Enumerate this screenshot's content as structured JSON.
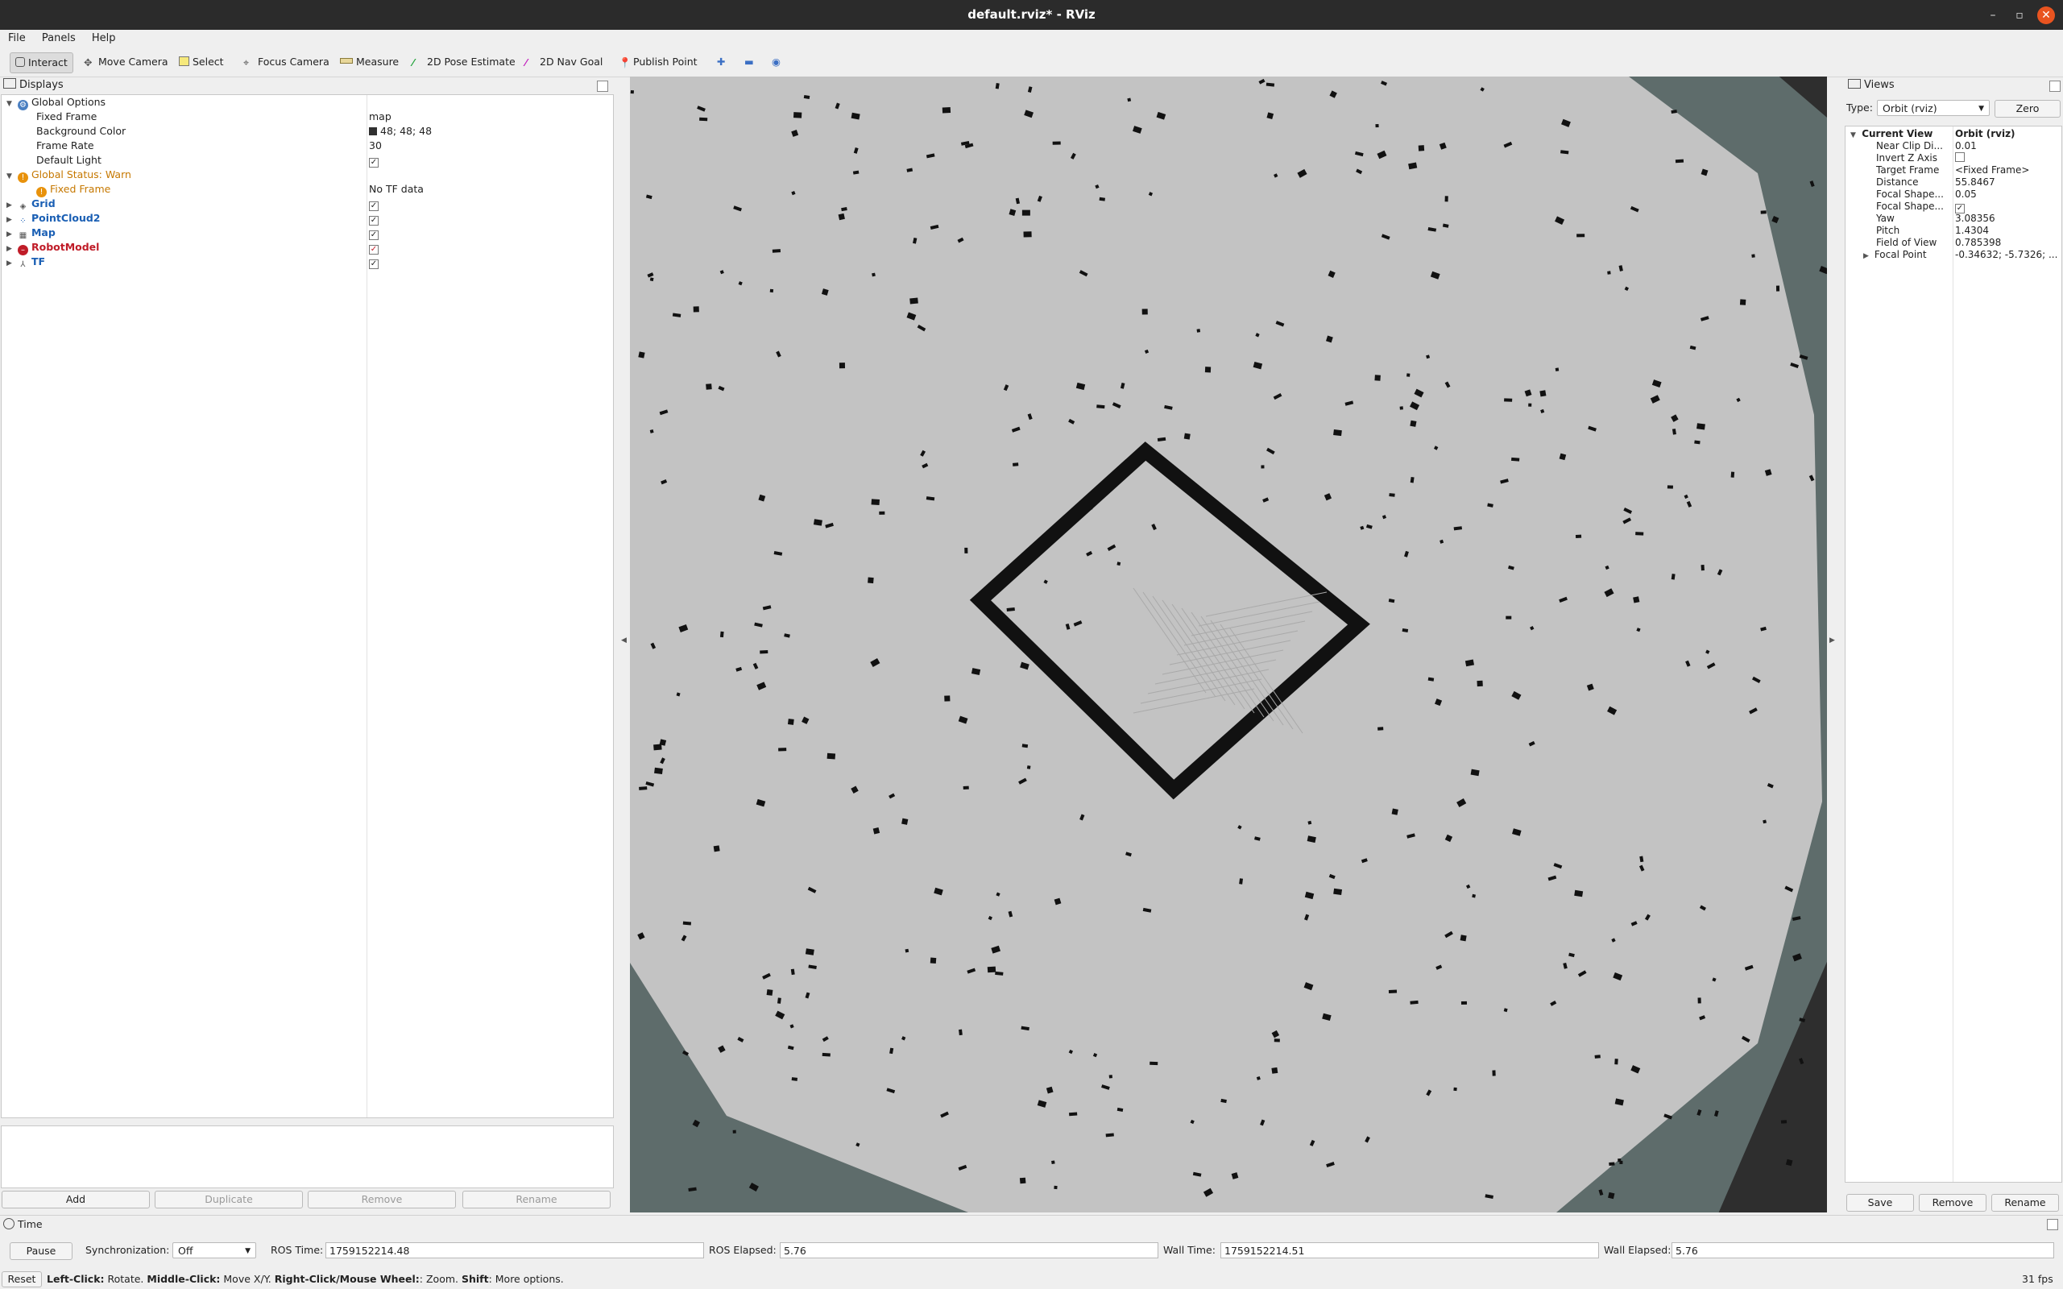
{
  "window": {
    "title": "default.rviz* - RViz",
    "minimize": "–",
    "maximize": "▫",
    "close": "✕"
  },
  "menu": [
    "File",
    "Panels",
    "Help"
  ],
  "toolbar": {
    "interact": "Interact",
    "move_camera": "Move Camera",
    "select": "Select",
    "focus_camera": "Focus Camera",
    "measure": "Measure",
    "pose_estimate": "2D Pose Estimate",
    "nav_goal": "2D Nav Goal",
    "publish_point": "Publish Point"
  },
  "displays": {
    "title": "Displays",
    "global_options": "Global Options",
    "fixed_frame_label": "Fixed Frame",
    "fixed_frame_value": "map",
    "bg_color_label": "Background Color",
    "bg_color_value": "48; 48; 48",
    "bg_color_swatch": "#303030",
    "frame_rate_label": "Frame Rate",
    "frame_rate_value": "30",
    "default_light_label": "Default Light",
    "default_light_checked": "✓",
    "global_status": "Global Status: Warn",
    "status_fixed_frame": "Fixed Frame",
    "status_fixed_frame_value": "No TF data",
    "items": [
      {
        "name": "Grid",
        "checked": "✓"
      },
      {
        "name": "PointCloud2",
        "checked": "✓"
      },
      {
        "name": "Map",
        "checked": "✓"
      },
      {
        "name": "RobotModel",
        "checked": "✓"
      },
      {
        "name": "TF",
        "checked": "✓"
      }
    ],
    "buttons": {
      "add": "Add",
      "duplicate": "Duplicate",
      "remove": "Remove",
      "rename": "Rename"
    }
  },
  "views": {
    "title": "Views",
    "type_label": "Type:",
    "type_value": "Orbit (rviz)",
    "zero": "Zero",
    "current_view": "Current View",
    "current_view_value": "Orbit (rviz)",
    "props": [
      {
        "label": "Near Clip Di...",
        "value": "0.01"
      },
      {
        "label": "Invert Z Axis",
        "value": ""
      },
      {
        "label": "Target Frame",
        "value": "<Fixed Frame>"
      },
      {
        "label": "Distance",
        "value": "55.8467"
      },
      {
        "label": "Focal Shape...",
        "value": "0.05"
      },
      {
        "label": "Focal Shape...",
        "value": "✓"
      },
      {
        "label": "Yaw",
        "value": "3.08356"
      },
      {
        "label": "Pitch",
        "value": "1.4304"
      },
      {
        "label": "Field of View",
        "value": "0.785398"
      },
      {
        "label": "Focal Point",
        "value": "-0.34632; -5.7326; ..."
      }
    ],
    "buttons": {
      "save": "Save",
      "remove": "Remove",
      "rename": "Rename"
    }
  },
  "time": {
    "title": "Time",
    "pause": "Pause",
    "sync_label": "Synchronization:",
    "sync_value": "Off",
    "ros_time_label": "ROS Time:",
    "ros_time": "1759152214.48",
    "ros_elapsed_label": "ROS Elapsed:",
    "ros_elapsed": "5.76",
    "wall_time_label": "Wall Time:",
    "wall_time": "1759152214.51",
    "wall_elapsed_label": "Wall Elapsed:",
    "wall_elapsed": "5.76"
  },
  "status": {
    "reset": "Reset",
    "left_click": "Left-Click:",
    "left_click_desc": " Rotate. ",
    "middle_click": "Middle-Click:",
    "middle_click_desc": " Move X/Y. ",
    "right_click": "Right-Click/Mouse Wheel:",
    "right_click_desc": ": Zoom. ",
    "shift": "Shift",
    "shift_desc": ": More options.",
    "fps": "31 fps"
  }
}
